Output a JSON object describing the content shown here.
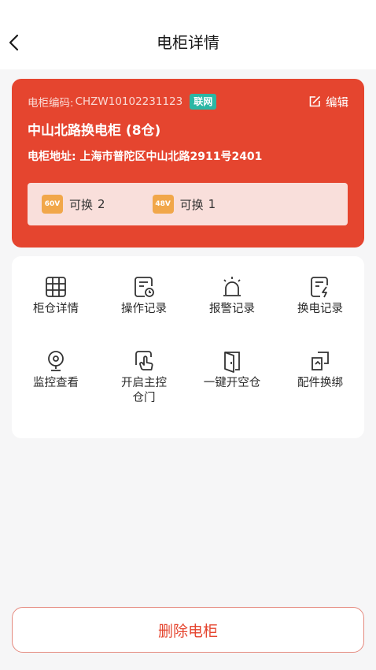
{
  "header": {
    "title": "电柜详情"
  },
  "cabinet": {
    "code_label": "电柜编码:",
    "code": "CHZW10102231123",
    "status_badge": "联网",
    "edit_label": "编辑",
    "name": "中山北路换电柜 (8仓)",
    "address_label": "电柜地址:",
    "address": "上海市普陀区中山北路2911号2401",
    "batteries": [
      {
        "voltage": "60V",
        "label": "可换",
        "count": "2"
      },
      {
        "voltage": "48V",
        "label": "可换",
        "count": "1"
      }
    ]
  },
  "functions": [
    {
      "label": "柜仓详情",
      "icon": "grid-icon"
    },
    {
      "label": "操作记录",
      "icon": "log-clock-icon"
    },
    {
      "label": "报警记录",
      "icon": "alarm-icon"
    },
    {
      "label": "换电记录",
      "icon": "swap-record-icon"
    },
    {
      "label": "监控查看",
      "icon": "camera-icon"
    },
    {
      "label": "开启主控\n仓门",
      "icon": "hand-tap-icon"
    },
    {
      "label": "一键开空仓",
      "icon": "door-icon"
    },
    {
      "label": "配件换绑",
      "icon": "rebind-icon"
    }
  ],
  "actions": {
    "delete_label": "删除电柜"
  },
  "colors": {
    "primary": "#e5452f",
    "badge": "#2bb7a4",
    "voltage": "#f1a74a",
    "battery_box": "#f9dfdb"
  }
}
